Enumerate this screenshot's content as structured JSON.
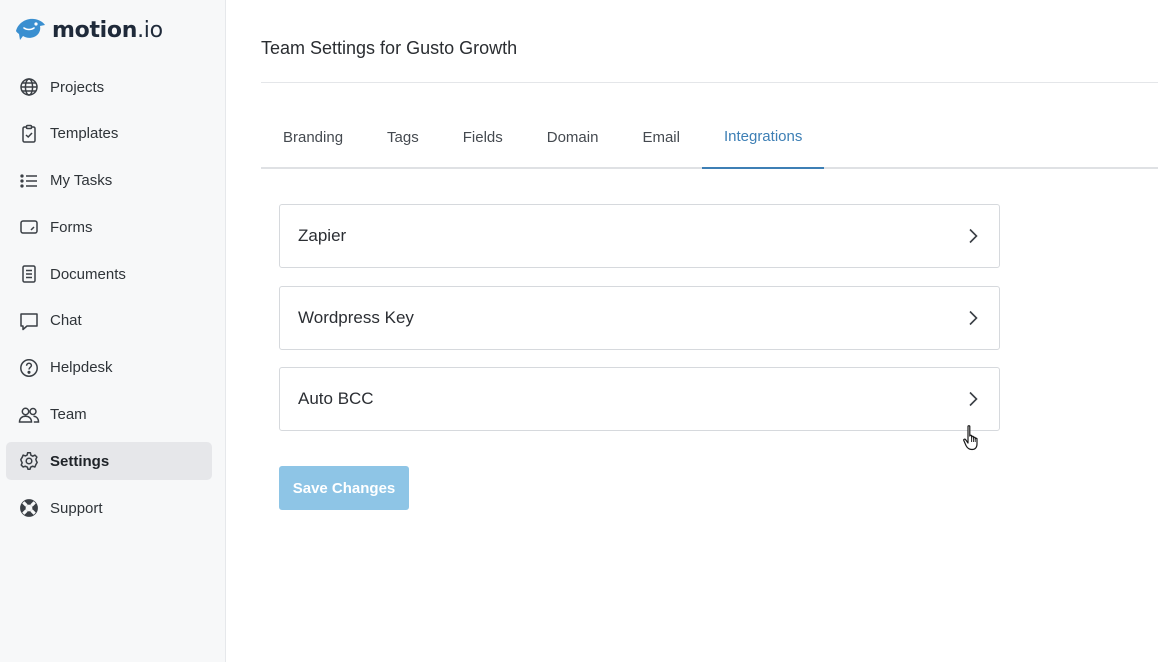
{
  "brand": {
    "name": "motion",
    "domain": ".io",
    "color": "#3a8fd0"
  },
  "sidebar": {
    "items": [
      {
        "label": "Projects",
        "icon": "globe-icon"
      },
      {
        "label": "Templates",
        "icon": "clipboard-check-icon"
      },
      {
        "label": "My Tasks",
        "icon": "list-icon"
      },
      {
        "label": "Forms",
        "icon": "form-icon"
      },
      {
        "label": "Documents",
        "icon": "document-icon"
      },
      {
        "label": "Chat",
        "icon": "chat-bubble-icon"
      },
      {
        "label": "Helpdesk",
        "icon": "question-circle-icon"
      },
      {
        "label": "Team",
        "icon": "users-icon"
      },
      {
        "label": "Settings",
        "icon": "gear-icon",
        "active": true
      },
      {
        "label": "Support",
        "icon": "lifebuoy-icon"
      }
    ]
  },
  "page": {
    "title": "Team Settings for Gusto Growth"
  },
  "tabs": [
    {
      "label": "Branding"
    },
    {
      "label": "Tags"
    },
    {
      "label": "Fields"
    },
    {
      "label": "Domain"
    },
    {
      "label": "Email"
    },
    {
      "label": "Integrations",
      "active": true
    }
  ],
  "integrations": [
    {
      "label": "Zapier"
    },
    {
      "label": "Wordpress Key"
    },
    {
      "label": "Auto BCC"
    }
  ],
  "actions": {
    "save_label": "Save Changes"
  },
  "colors": {
    "accent": "#3d7fb5",
    "save_button": "#8ec5e6",
    "active_nav_bg": "#e6e7ea"
  }
}
